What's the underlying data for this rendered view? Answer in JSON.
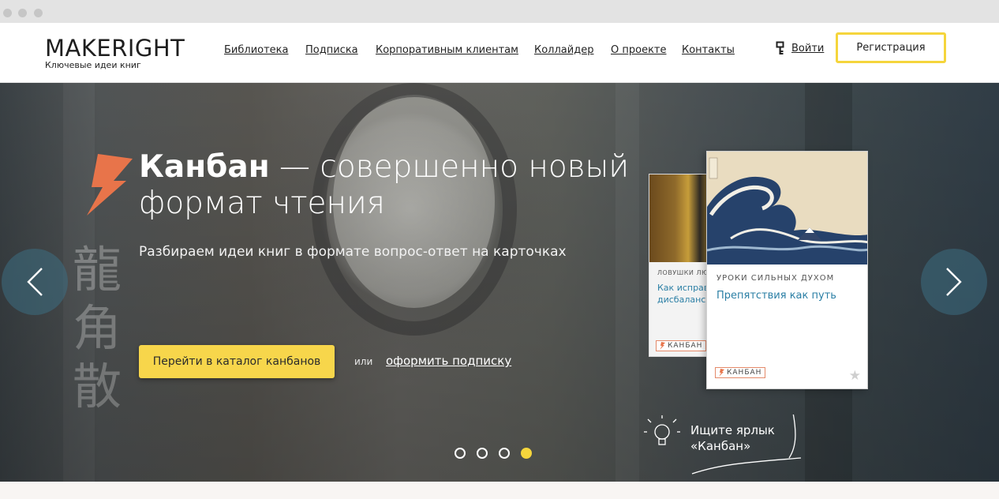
{
  "header": {
    "logo_title": "MAKERIGHT",
    "logo_subtitle": "Ключевые идеи книг",
    "nav": [
      {
        "label": "Библиотека"
      },
      {
        "label": "Подписка"
      },
      {
        "label": "Корпоративным клиентам"
      },
      {
        "label": "Коллайдер"
      },
      {
        "label": "О проекте"
      },
      {
        "label": "Контакты"
      }
    ],
    "login_label": "Войти",
    "register_label": "Регистрация"
  },
  "hero": {
    "title_bold": "Канбан",
    "title_rest": " — совершенно новый формат чтения",
    "subtitle": "Разбираем идеи книг в формате вопрос-ответ на карточках",
    "cta_label": "Перейти в каталог канбанов",
    "or_label": "или",
    "subscribe_label": "оформить подписку",
    "hint_line1": "Ищите ярлык",
    "hint_line2": "«Канбан»",
    "slides_total": 4,
    "active_slide": 4
  },
  "cards": {
    "back": {
      "label": "ЛОВУШКИ ЛЮБ",
      "title_line1": "Как исправи",
      "title_line2": "дисбаланс в",
      "badge": "КАНБАН"
    },
    "front": {
      "label": "УРОКИ СИЛЬНЫХ ДУХОМ",
      "title": "Препятствия как путь",
      "badge": "КАНБАН"
    }
  },
  "colors": {
    "accent_yellow": "#f5d53c",
    "link_blue": "#2b7fa5",
    "bolt_orange": "#e8744a"
  }
}
